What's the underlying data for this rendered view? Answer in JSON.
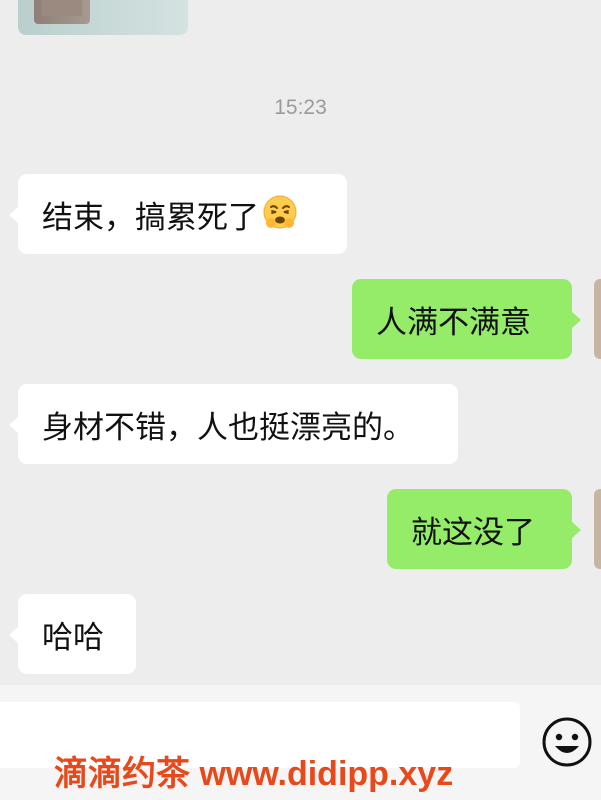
{
  "chat": {
    "timestamp": "15:23",
    "messages": [
      {
        "side": "in",
        "text": "结束，搞累死了",
        "emoji": "weary-face-emoji"
      },
      {
        "side": "out",
        "text": "人满不满意"
      },
      {
        "side": "in",
        "text": "身材不错，人也挺漂亮的。"
      },
      {
        "side": "out",
        "text": "就这没了"
      },
      {
        "side": "in",
        "text": "哈哈"
      }
    ]
  },
  "input_bar": {
    "input_value": "",
    "emoji_button_icon": "smile-face-icon"
  },
  "watermark": {
    "text": "滴滴约茶 www.didipp.xyz"
  },
  "colors": {
    "background": "#ededed",
    "bubble_in": "#ffffff",
    "bubble_out": "#95ec69",
    "timestamp": "#9a9a9a",
    "watermark": "#e8491a"
  }
}
